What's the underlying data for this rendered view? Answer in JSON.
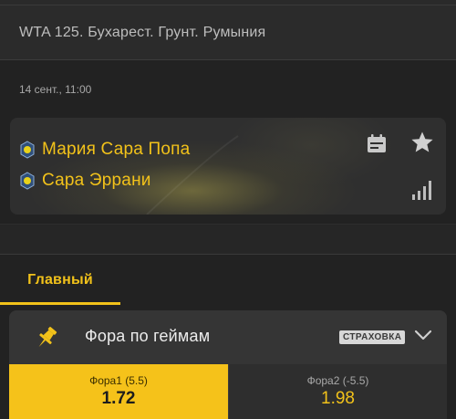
{
  "header": {
    "tournament_title": "WTA 125. Бухарест. Грунт. Румыния"
  },
  "match": {
    "datetime": "14 сент., 11:00",
    "player1": "Мария Сара Попа",
    "player2": "Сара Эррани",
    "icons": [
      "calendar-icon",
      "star-icon",
      "stats-icon",
      "player-badge-icon"
    ]
  },
  "tabs": [
    {
      "label": "Главный",
      "active": true
    }
  ],
  "market": {
    "title": "Фора по геймам",
    "badge": "СТРАХОВКА",
    "icons": [
      "pin-icon",
      "chevron-down-icon"
    ],
    "odds": [
      {
        "label": "Фора1 (5.5)",
        "value": "1.72",
        "selected": true
      },
      {
        "label": "Фора2 (-5.5)",
        "value": "1.98",
        "selected": false
      }
    ]
  },
  "colors": {
    "accent": "#f2c21a",
    "background": "#222222",
    "card": "#353535"
  }
}
